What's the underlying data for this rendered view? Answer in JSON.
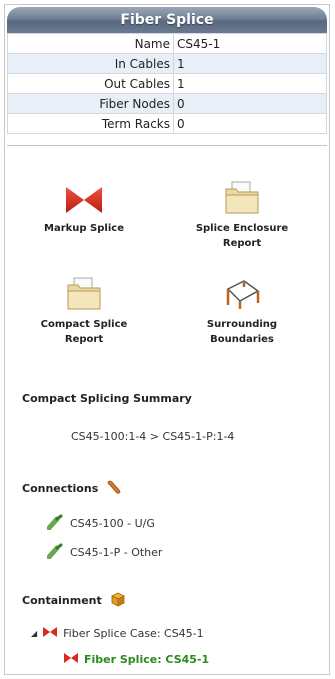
{
  "title": "Fiber Splice",
  "properties": [
    {
      "label": "Name",
      "value": "CS45-1"
    },
    {
      "label": "In Cables",
      "value": "1"
    },
    {
      "label": "Out Cables",
      "value": "1"
    },
    {
      "label": "Fiber Nodes",
      "value": "0"
    },
    {
      "label": "Term Racks",
      "value": "0"
    }
  ],
  "tools": [
    {
      "label": "Markup Splice",
      "icon": "bowtie-splice-icon"
    },
    {
      "label": "Splice Enclosure Report",
      "icon": "folder-report-icon"
    },
    {
      "label": "Compact Splice Report",
      "icon": "folder-report-icon"
    },
    {
      "label": "Surrounding Boundaries",
      "icon": "boundary-icon"
    }
  ],
  "summary": {
    "title": "Compact Splicing Summary",
    "text": "CS45-100:1-4 > CS45-1-P:1-4"
  },
  "connections": {
    "title": "Connections",
    "icon": "wrench-icon",
    "items": [
      {
        "label": "CS45-100 - U/G",
        "icon": "cable-icon"
      },
      {
        "label": "CS45-1-P - Other",
        "icon": "cable-icon"
      }
    ]
  },
  "containment": {
    "title": "Containment",
    "icon": "box-icon",
    "items": [
      {
        "label": "Fiber Splice Case: CS45-1",
        "expanded": true
      },
      {
        "label": "Fiber Splice: CS45-1",
        "current": true
      }
    ]
  },
  "colors": {
    "header_gradient_mid": "#57687e",
    "alt_row": "#e9eff6",
    "splice_red": "#d62a1e",
    "current_green": "#2a8a1c"
  }
}
